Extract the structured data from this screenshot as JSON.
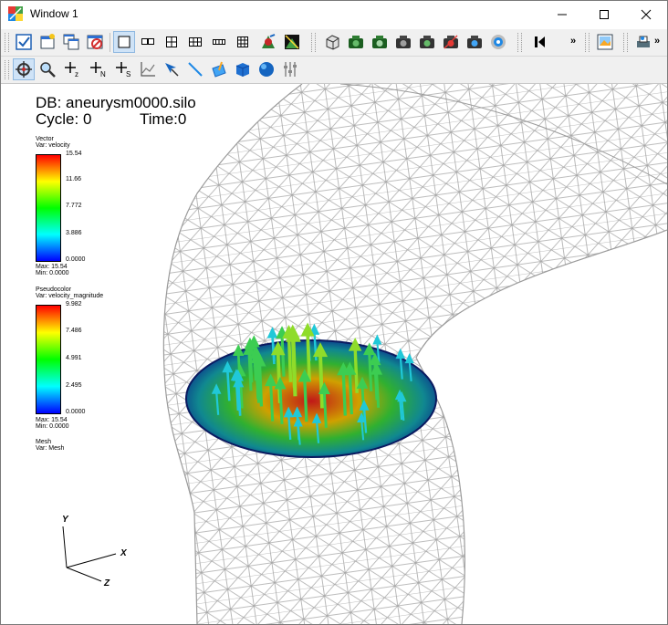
{
  "window": {
    "title": "Window 1",
    "controls": [
      "minimize-icon",
      "maximize-icon",
      "close-icon"
    ]
  },
  "toolbar1": {
    "buttons": [
      "active-window-checkbox-icon",
      "new-window-icon",
      "copy-window-icon",
      "clear-window-icon",
      "layout-1x1-icon",
      "layout-1x2-icon",
      "layout-2x2-icon",
      "layout-2x3-icon",
      "layout-3x3-icon",
      "plot-add-icon",
      "plot-operator-icon",
      "box-view-icon",
      "camera-icon",
      "camera-icon",
      "camera-icon",
      "camera-icon",
      "camera-icon",
      "camera-icon",
      "camera-icon",
      "animation-step-back-icon",
      "save-image-icon",
      "print-icon"
    ],
    "overflow": "»"
  },
  "toolbar2": {
    "buttons": [
      "navigate-mode-icon",
      "zoom-mode-icon",
      "zone-pick-icon",
      "node-pick-icon",
      "spreadsheet-pick-icon",
      "lineout-icon",
      "pick-arrow-icon",
      "line-tool-icon",
      "plane-tool-icon",
      "box-tool-icon",
      "sphere-tool-icon",
      "axis-restrict-icon"
    ],
    "pick_labels": {
      "z": "z",
      "n": "N",
      "s": "S"
    }
  },
  "annotation": {
    "db": "DB: aneurysm0000.silo",
    "cycle": "Cycle: 0",
    "time": "Time:0"
  },
  "legends": {
    "vector": {
      "title": "Vector",
      "var": "Var: velocity",
      "ticks": [
        "15.54",
        "11.66",
        "7.772",
        "3.886",
        "0.0000"
      ],
      "max": "Max: 15.54",
      "min": "Min: 0.0000"
    },
    "pseudocolor": {
      "title": "Pseudocolor",
      "var": "Var: velocity_magnitude",
      "ticks": [
        "9.982",
        "7.486",
        "4.991",
        "2.495",
        "0.0000"
      ],
      "max": "Max: 15.54",
      "min": "Min: 0.0000"
    },
    "mesh": {
      "title": "Mesh",
      "var": "Var: Mesh"
    }
  },
  "triad": {
    "y": "Y",
    "x": "X",
    "z": "Z"
  },
  "colors": {
    "mesh": "#a8a8a8",
    "colormap": [
      "#ff0000",
      "#ffff00",
      "#00ff00",
      "#00ffff",
      "#0000ff"
    ]
  }
}
